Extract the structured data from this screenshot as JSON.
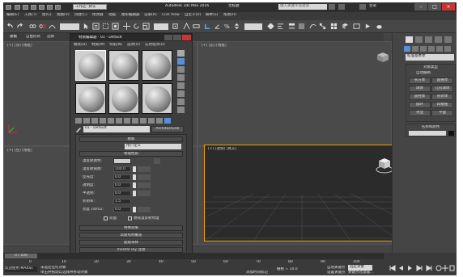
{
  "titlebar": {
    "doc": "工作区: 默认",
    "app_title": "Autodesk 3ds Max 2016",
    "file_name": "无标题",
    "search_placeholder": "键入关键字或短语",
    "login": "登录"
  },
  "menubar": {
    "items": [
      "编辑(E)",
      "工具(T)",
      "组(G)",
      "视图(V)",
      "创建(C)",
      "修改器",
      "动画",
      "图形编辑器",
      "渲染(R)",
      "Civil View",
      "自定义(U)",
      "脚本(S)",
      "帮助(H)"
    ]
  },
  "ribbon": {
    "tabs": [
      "建模",
      "自由形式",
      "选择",
      "对象绘制",
      "填充"
    ]
  },
  "viewports": {
    "top_left": "[+] [顶] [线框]",
    "top_right": "[+] [前] [线框]",
    "bottom_left": "[+] [左] [线框]",
    "perspective": "[+] [透视] [真实]"
  },
  "material_editor": {
    "title": "材质编辑器 - 01 - Default",
    "menu": [
      "模式(D)",
      "材质(M)",
      "导航(N)",
      "选项(O)",
      "实用程序(U)"
    ],
    "material_name": "01 - Default",
    "material_type": "Architectural",
    "rollout_template": "模板",
    "template_value": "用户定义",
    "rollout_physical": "物理性质",
    "fields": [
      {
        "label": "漫反射颜色:",
        "value": ""
      },
      {
        "label": "漫反射贴图:",
        "value": "100.0"
      },
      {
        "label": "反光度:",
        "value": "0.0"
      },
      {
        "label": "透明度:",
        "value": "0.0"
      },
      {
        "label": "半透明:",
        "value": "0.0"
      },
      {
        "label": "折射率:",
        "value": "1.5"
      },
      {
        "label": "亮度 cd/m2:",
        "value": "0.0"
      }
    ],
    "check1": "双面",
    "check2": "粗糙漫反射纹理",
    "rollouts_bottom": [
      "特殊效果",
      "高级照明覆盖",
      "超级采样",
      "mental ray 连接"
    ]
  },
  "command_panel": {
    "object_type": "对象类型",
    "auto_grid": "自动栅格",
    "buttons": [
      "长方体",
      "圆锥体",
      "球体",
      "几何球体",
      "圆柱体",
      "管状体",
      "圆环",
      "四棱锥",
      "茶壶",
      "平面"
    ],
    "standard": "标准基本体",
    "name_color": "名称和颜色"
  },
  "timeline": {
    "frame": "0 / 100",
    "status1": "未选定任何对象",
    "status2": "单击并拖动以选择并移动对象",
    "welcome": "欢迎使用 MAXSc",
    "grid": "栅格 = 10.0",
    "auto_key": "自动关键点",
    "selected": "选定对象",
    "set_key": "设置关键点",
    "filter": "关键点过滤器...",
    "add_tag": "添加时间标记",
    "ticks": [
      "0",
      "10",
      "20",
      "30",
      "40",
      "50",
      "60",
      "70",
      "80",
      "90",
      "100"
    ]
  },
  "colors": {
    "accent": "#f0a000",
    "selected_blue": "#5a8fd8"
  }
}
